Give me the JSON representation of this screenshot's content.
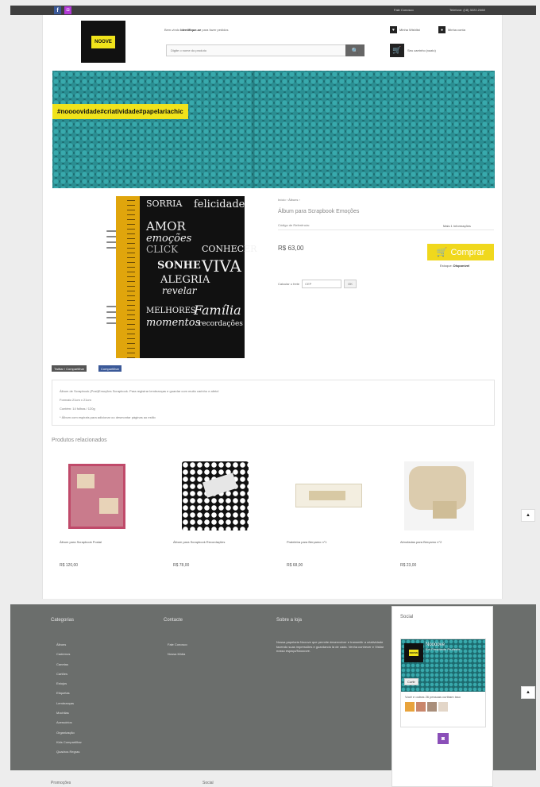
{
  "topbar": {
    "facebook_glyph": "f",
    "instagram_glyph": "◘",
    "contact": "Fale Conosco",
    "phone": "Telefone: (18) 3222-2468"
  },
  "header": {
    "logo_text": "NOOVE",
    "welcome_prefix": "Bem-vindo",
    "welcome_link": "Identifique-se",
    "welcome_suffix": "para fazer pedidos",
    "search_placeholder": "Digite o nome do produto",
    "search_glyph": "🔍",
    "wishlist_label": "Minha Wishlist",
    "account_label": "Minha conta",
    "cart_label": "Seu carrinho (vazio)"
  },
  "banner": {
    "tag": "#noooovidade#criatividade#papelariachic"
  },
  "product": {
    "breadcrumb": "Início › Álbuns ›",
    "title": "Álbum para Scrapbook Emoções",
    "ref": "Código de Referência:",
    "more_info": "Mais 1 Informações",
    "price": "R$ 63,00",
    "buy_label": "Comprar",
    "availability_label": "Estoque:",
    "availability_value": "Disponível",
    "shipping_label": "Calcular o frete",
    "shipping_placeholder": "CEP",
    "shipping_button": "OK",
    "cover_words": [
      "SORRIA",
      "felicidade",
      "AMOR",
      "emoções",
      "CLICK",
      "CONHECER",
      "SONHE",
      "VIVA",
      "ALEGRIA",
      "revelar",
      "MELHORES",
      "Família",
      "momentos",
      "recordações"
    ]
  },
  "share": {
    "tweet": "Twittar / Compartilhar",
    "facebook": "Compartilhar"
  },
  "description": [
    "Álbum de Scrapbook (Post)Emoções Scrapbook. Para registrar lembranças e guardar com muito carinho e afeto!",
    "Formato 21cm x 21cm",
    "Contém: 14 folhas / 120g",
    "* Álbum com espirais para adicionar ou desmontar páginas ao estilo"
  ],
  "related": {
    "title": "Produtos relacionados",
    "items": [
      {
        "name": "Álbum para Scrapbook Postal",
        "price": "R$ 120,00"
      },
      {
        "name": "Álbum para Scrapbook Recordações",
        "price": "R$ 78,00"
      },
      {
        "name": "Prateleira para Berçamo n°1",
        "price": "R$ 68,00"
      },
      {
        "name": "Almofadas para Berçamo n°2",
        "price": "R$ 23,00"
      }
    ]
  },
  "footer": {
    "categories_title": "Categorias",
    "categories": [
      "Álbuns",
      "Cadernos",
      "Canetas",
      "Cartões",
      "Estojos",
      "Etiquetas",
      "Lembranças",
      "Mochilas",
      "Acessórios",
      "Organização",
      "Kids Compartilhar",
      "Quadros Regras"
    ],
    "contact_title": "Contacte",
    "contact_links": [
      "Fale Conosco",
      "Nossa Mídia"
    ],
    "about_title": "Sobre a loja",
    "about_text": "Nossa papelaria Nooove que permite desenvolver e transmitir a criatividade fazendo suas impressões e guardando lá de cada. Venha conhecer e Visitar nosso espaço/Noooove."
  },
  "social": {
    "title": "Social",
    "page_logo": "NOOVE",
    "page_name": "Noooove",
    "page_sub": "Em Presidente Prudente",
    "like": "Curtir",
    "friends_text": "Você e outras 26 pessoas curtiram isso",
    "instagram_glyph": "◙",
    "face_colors": [
      "#e8a33c",
      "#c9866b",
      "#a98e7a",
      "#e3d6c8"
    ]
  },
  "scroll_glyph": "▲",
  "bottom": {
    "left": "Promoções",
    "right": "Social"
  }
}
